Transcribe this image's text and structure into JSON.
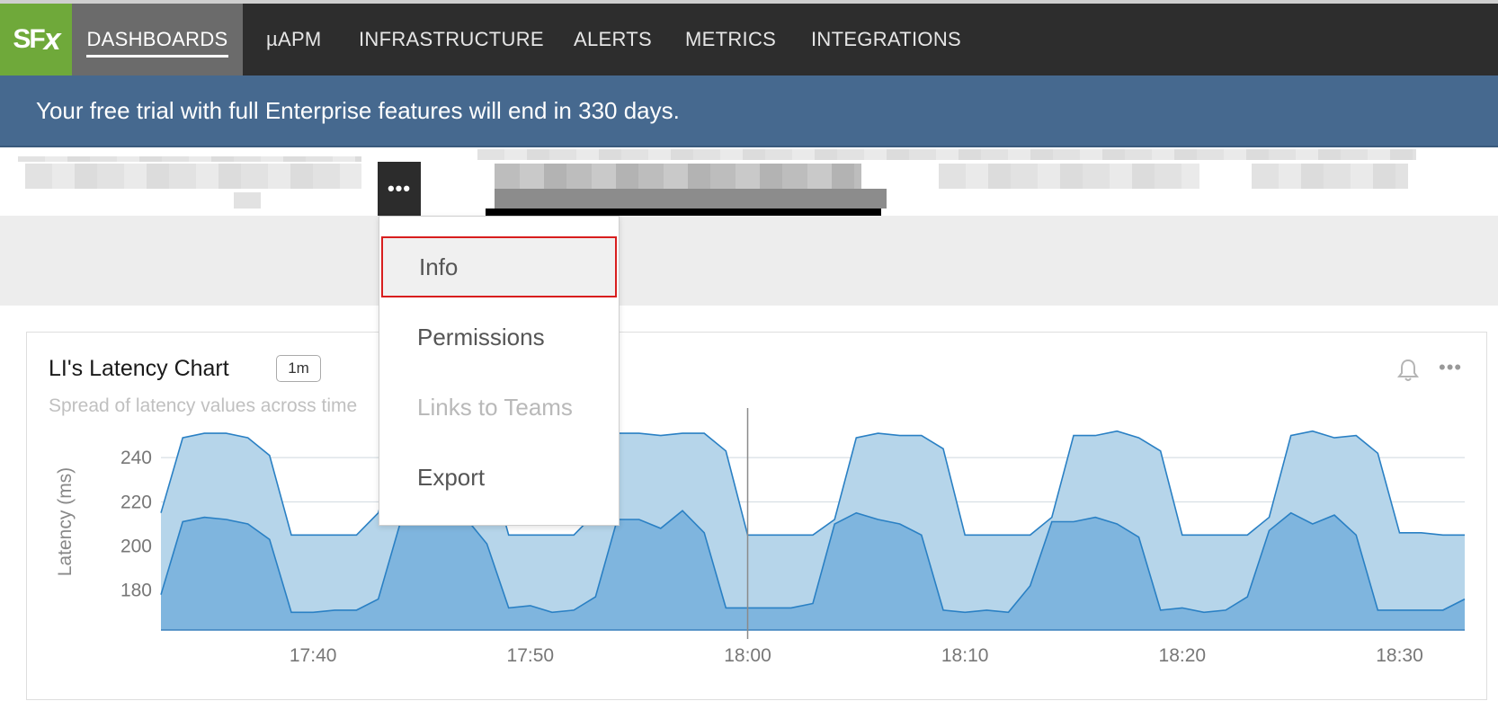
{
  "nav": {
    "logo_text": "SF",
    "logo_x": "x",
    "items": [
      {
        "label": "DASHBOARDS",
        "active": true
      },
      {
        "label": "µAPM"
      },
      {
        "label": "INFRASTRUCTURE"
      },
      {
        "label": "ALERTS"
      },
      {
        "label": "METRICS"
      },
      {
        "label": "INTEGRATIONS"
      }
    ]
  },
  "banner": {
    "text": "Your free trial with full Enterprise features will end in 330 days."
  },
  "menu_button": {
    "label": "•••"
  },
  "dropdown": {
    "items": [
      {
        "label": "Info",
        "state": "selected"
      },
      {
        "label": "Permissions"
      },
      {
        "label": "Links to Teams",
        "state": "disabled"
      },
      {
        "label": "Export"
      }
    ]
  },
  "chart_card": {
    "title": "LI's Latency Chart",
    "resolution": "1m",
    "description": "Spread of latency values across time",
    "more_label": "•••"
  },
  "chart_data": {
    "type": "area",
    "ylabel": "Latency (ms)",
    "xlabel": "",
    "ylim": [
      162,
      260
    ],
    "yticks": [
      180,
      200,
      220,
      240
    ],
    "x_ticks": [
      "17:40",
      "17:50",
      "18:00",
      "18:10",
      "18:20",
      "18:30"
    ],
    "x": [
      "17:33",
      "17:34",
      "17:35",
      "17:36",
      "17:37",
      "17:38",
      "17:39",
      "17:40",
      "17:41",
      "17:42",
      "17:43",
      "17:44",
      "17:45",
      "17:46",
      "17:47",
      "17:48",
      "17:49",
      "17:50",
      "17:51",
      "17:52",
      "17:53",
      "17:54",
      "17:55",
      "17:56",
      "17:57",
      "17:58",
      "17:59",
      "18:00",
      "18:01",
      "18:02",
      "18:03",
      "18:04",
      "18:05",
      "18:06",
      "18:07",
      "18:08",
      "18:09",
      "18:10",
      "18:11",
      "18:12",
      "18:13",
      "18:14",
      "18:15",
      "18:16",
      "18:17",
      "18:18",
      "18:19",
      "18:20",
      "18:21",
      "18:22",
      "18:23",
      "18:24",
      "18:25",
      "18:26",
      "18:27",
      "18:28",
      "18:29",
      "18:30",
      "18:31",
      "18:32",
      "18:33"
    ],
    "cursor_x": "18:00",
    "colors": {
      "upper": "#b6d5ea",
      "lower": "#7fb5de",
      "line": "#2a80c4",
      "grid": "#cfd8df"
    },
    "series": [
      {
        "values": [
          215,
          249,
          251,
          251,
          249,
          241,
          205,
          205,
          205,
          205,
          215,
          249,
          251,
          251,
          249,
          241,
          205,
          205,
          205,
          205,
          215,
          251,
          251,
          250,
          251,
          251,
          243,
          205,
          205,
          205,
          205,
          212,
          249,
          251,
          250,
          250,
          244,
          205,
          205,
          205,
          205,
          213,
          250,
          250,
          252,
          249,
          243,
          205,
          205,
          205,
          205,
          213,
          250,
          252,
          249,
          250,
          242,
          206,
          206,
          205,
          205
        ]
      },
      {
        "values": [
          178,
          211,
          213,
          212,
          210,
          203,
          170,
          170,
          171,
          171,
          176,
          210,
          211,
          213,
          213,
          201,
          172,
          173,
          170,
          171,
          177,
          212,
          212,
          208,
          216,
          206,
          172,
          172,
          172,
          172,
          174,
          210,
          215,
          212,
          210,
          205,
          171,
          170,
          171,
          170,
          182,
          211,
          211,
          213,
          210,
          204,
          171,
          172,
          170,
          171,
          177,
          207,
          215,
          210,
          214,
          205,
          171,
          171,
          171,
          171,
          176
        ]
      }
    ]
  }
}
